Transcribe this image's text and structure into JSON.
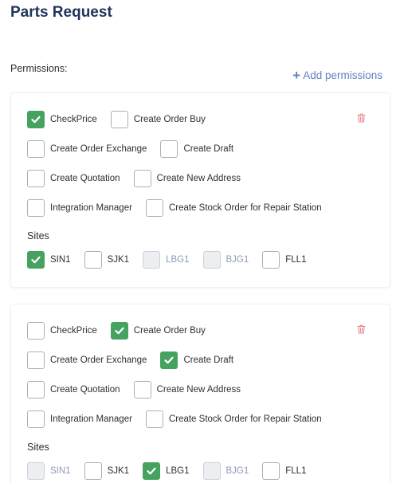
{
  "page": {
    "title": "Parts Request"
  },
  "permissions_label": "Permissions:",
  "add_permissions_label": "Add permissions",
  "colors": {
    "checked": "#45a35f",
    "accent": "#6180c4",
    "title": "#21345a",
    "trash": "#e8868b"
  },
  "cards": [
    {
      "rows": [
        [
          {
            "label": "CheckPrice",
            "checked": true
          },
          {
            "label": "Create Order Buy",
            "checked": false
          }
        ],
        [
          {
            "label": "Create Order Exchange",
            "checked": false
          },
          {
            "label": "Create Draft",
            "checked": false
          }
        ],
        [
          {
            "label": "Create Quotation",
            "checked": false
          },
          {
            "label": "Create New Address",
            "checked": false
          }
        ],
        [
          {
            "label": "Integration Manager",
            "checked": false
          },
          {
            "label": "Create Stock Order for Repair Station",
            "checked": false
          }
        ]
      ],
      "sites_label": "Sites",
      "sites": [
        {
          "label": "SIN1",
          "checked": true,
          "disabled": false
        },
        {
          "label": "SJK1",
          "checked": false,
          "disabled": false
        },
        {
          "label": "LBG1",
          "checked": false,
          "disabled": true
        },
        {
          "label": "BJG1",
          "checked": false,
          "disabled": true
        },
        {
          "label": "FLL1",
          "checked": false,
          "disabled": false
        }
      ]
    },
    {
      "rows": [
        [
          {
            "label": "CheckPrice",
            "checked": false
          },
          {
            "label": "Create Order Buy",
            "checked": true
          }
        ],
        [
          {
            "label": "Create Order Exchange",
            "checked": false
          },
          {
            "label": "Create Draft",
            "checked": true
          }
        ],
        [
          {
            "label": "Create Quotation",
            "checked": false
          },
          {
            "label": "Create New Address",
            "checked": false
          }
        ],
        [
          {
            "label": "Integration Manager",
            "checked": false
          },
          {
            "label": "Create Stock Order for Repair Station",
            "checked": false
          }
        ]
      ],
      "sites_label": "Sites",
      "sites": [
        {
          "label": "SIN1",
          "checked": false,
          "disabled": true
        },
        {
          "label": "SJK1",
          "checked": false,
          "disabled": false
        },
        {
          "label": "LBG1",
          "checked": true,
          "disabled": false
        },
        {
          "label": "BJG1",
          "checked": false,
          "disabled": true
        },
        {
          "label": "FLL1",
          "checked": false,
          "disabled": false
        }
      ]
    }
  ]
}
